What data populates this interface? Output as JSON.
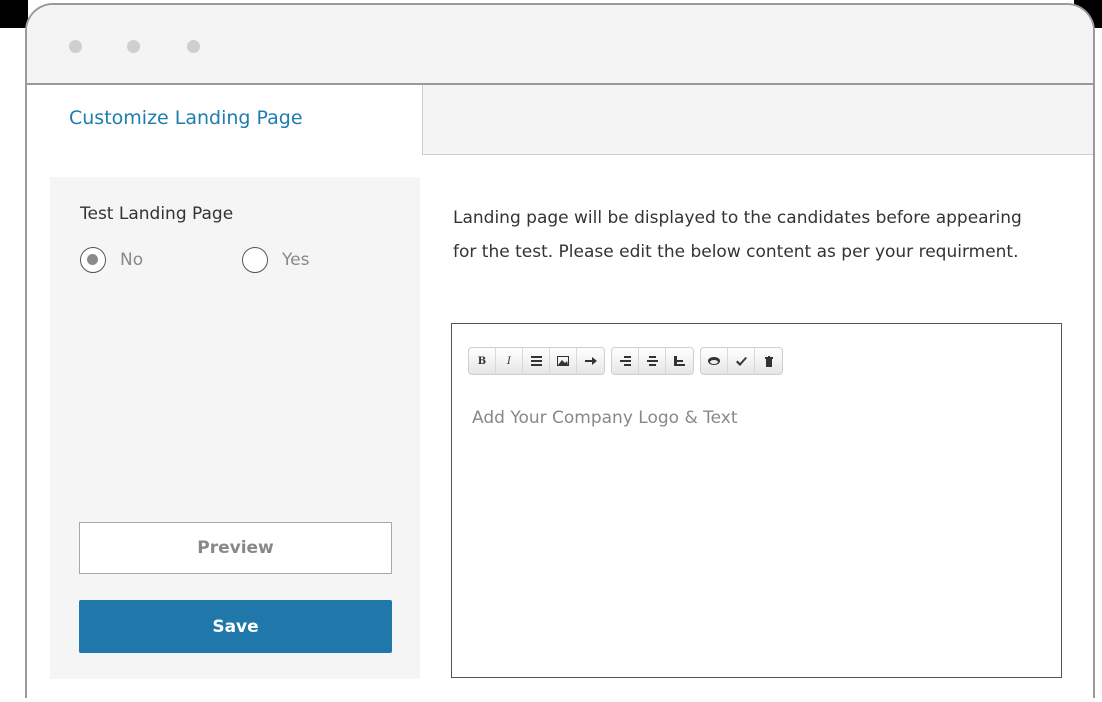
{
  "window": {
    "controls": [
      "dot-1",
      "dot-2",
      "dot-3"
    ]
  },
  "tab": {
    "label": "Customize Landing Page"
  },
  "left_panel": {
    "title": "Test Landing Page",
    "radio_options": [
      {
        "label": "No",
        "checked": true
      },
      {
        "label": "Yes",
        "checked": false
      }
    ],
    "preview_label": "Preview",
    "save_label": "Save"
  },
  "description": "Landing page will be displayed to the candidates before appearing for the test. Please edit the below content as per your requirment.",
  "editor": {
    "placeholder": "Add Your Company Logo & Text",
    "toolbar": {
      "bold_label": "B",
      "italic_label": "I",
      "icons": [
        "list-icon",
        "image-icon",
        "indent-arrow-icon",
        "align-left-icon",
        "align-center-icon",
        "align-right-icon",
        "eye-icon",
        "check-icon",
        "trash-icon"
      ]
    }
  },
  "colors": {
    "accent": "#1f77aa",
    "tab_text": "#1f7cb0",
    "border": "#9a9a9a"
  }
}
